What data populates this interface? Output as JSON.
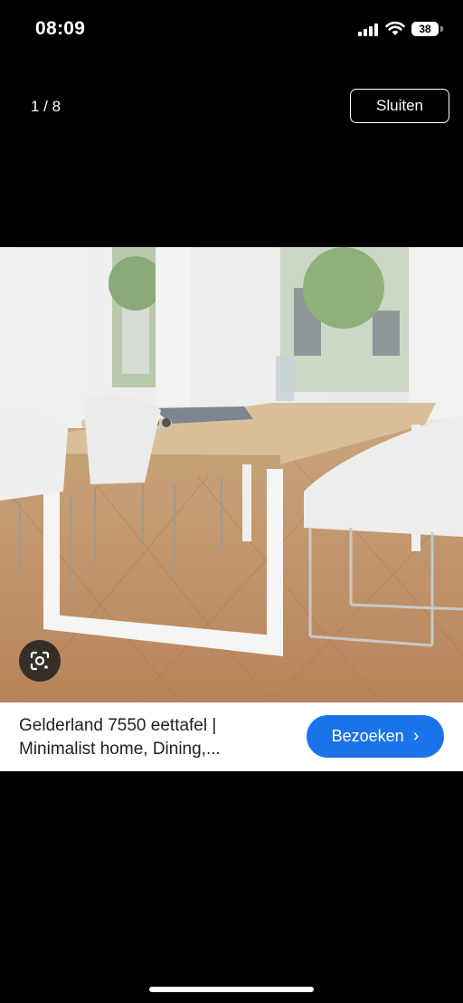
{
  "status_bar": {
    "time": "08:09",
    "battery": "38"
  },
  "viewer": {
    "counter": "1 / 8",
    "close_label": "Sluiten"
  },
  "result": {
    "title_line1": "Gelderland 7550 eettafel |",
    "title_line2": "Minimalist home, Dining,...",
    "visit_label": "Bezoeken",
    "visit_chevron": "›"
  },
  "icons": {
    "lens": "google-lens-icon",
    "signal": "cellular-signal-icon",
    "wifi": "wifi-icon"
  },
  "colors": {
    "background": "#000000",
    "accent": "#1a73e8",
    "info_bar": "#ffffff"
  }
}
